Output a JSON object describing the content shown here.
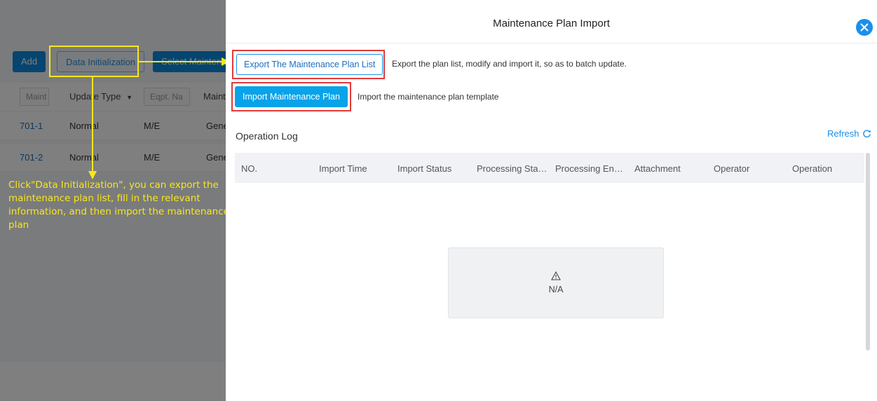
{
  "background_page": {
    "toolbar": {
      "add_label": "Add",
      "data_init_label": "Data Initialization",
      "select_label": "Select Maintenance"
    },
    "filters": {
      "col1": "Maint",
      "update_type": "Update Type",
      "eqpt_name": "Eqpt. Na",
      "col4": "Maint"
    },
    "rows": [
      {
        "id": "701-1",
        "update_type": "Normal",
        "dept": "M/E",
        "extra": "Gene"
      },
      {
        "id": "701-2",
        "update_type": "Normal",
        "dept": "M/E",
        "extra": "Gene"
      }
    ]
  },
  "annotation": {
    "text": "Click\"Data Initialization\", you can export the maintenance plan list, fill in the relevant information, and then import the maintenance plan",
    "color": "#f6e71d"
  },
  "drawer": {
    "title": "Maintenance Plan Import",
    "close_icon": "close-icon",
    "export": {
      "label": "Export The Maintenance Plan List",
      "description": "Export the plan list, modify and import it, so as to batch update."
    },
    "import": {
      "label": "Import Maintenance Plan",
      "description": "Import the maintenance plan template"
    },
    "operation_log": {
      "title": "Operation Log",
      "refresh_label": "Refresh",
      "columns": [
        "NO.",
        "Import Time",
        "Import Status",
        "Processing Sta…",
        "Processing En…",
        "Attachment",
        "Operator",
        "Operation"
      ],
      "empty_icon": "warning-icon",
      "empty_text": "N/A"
    }
  },
  "colors": {
    "primary": "#08a3e8",
    "accent_blue": "#1a90ea",
    "highlight_red": "#e23a3a"
  }
}
